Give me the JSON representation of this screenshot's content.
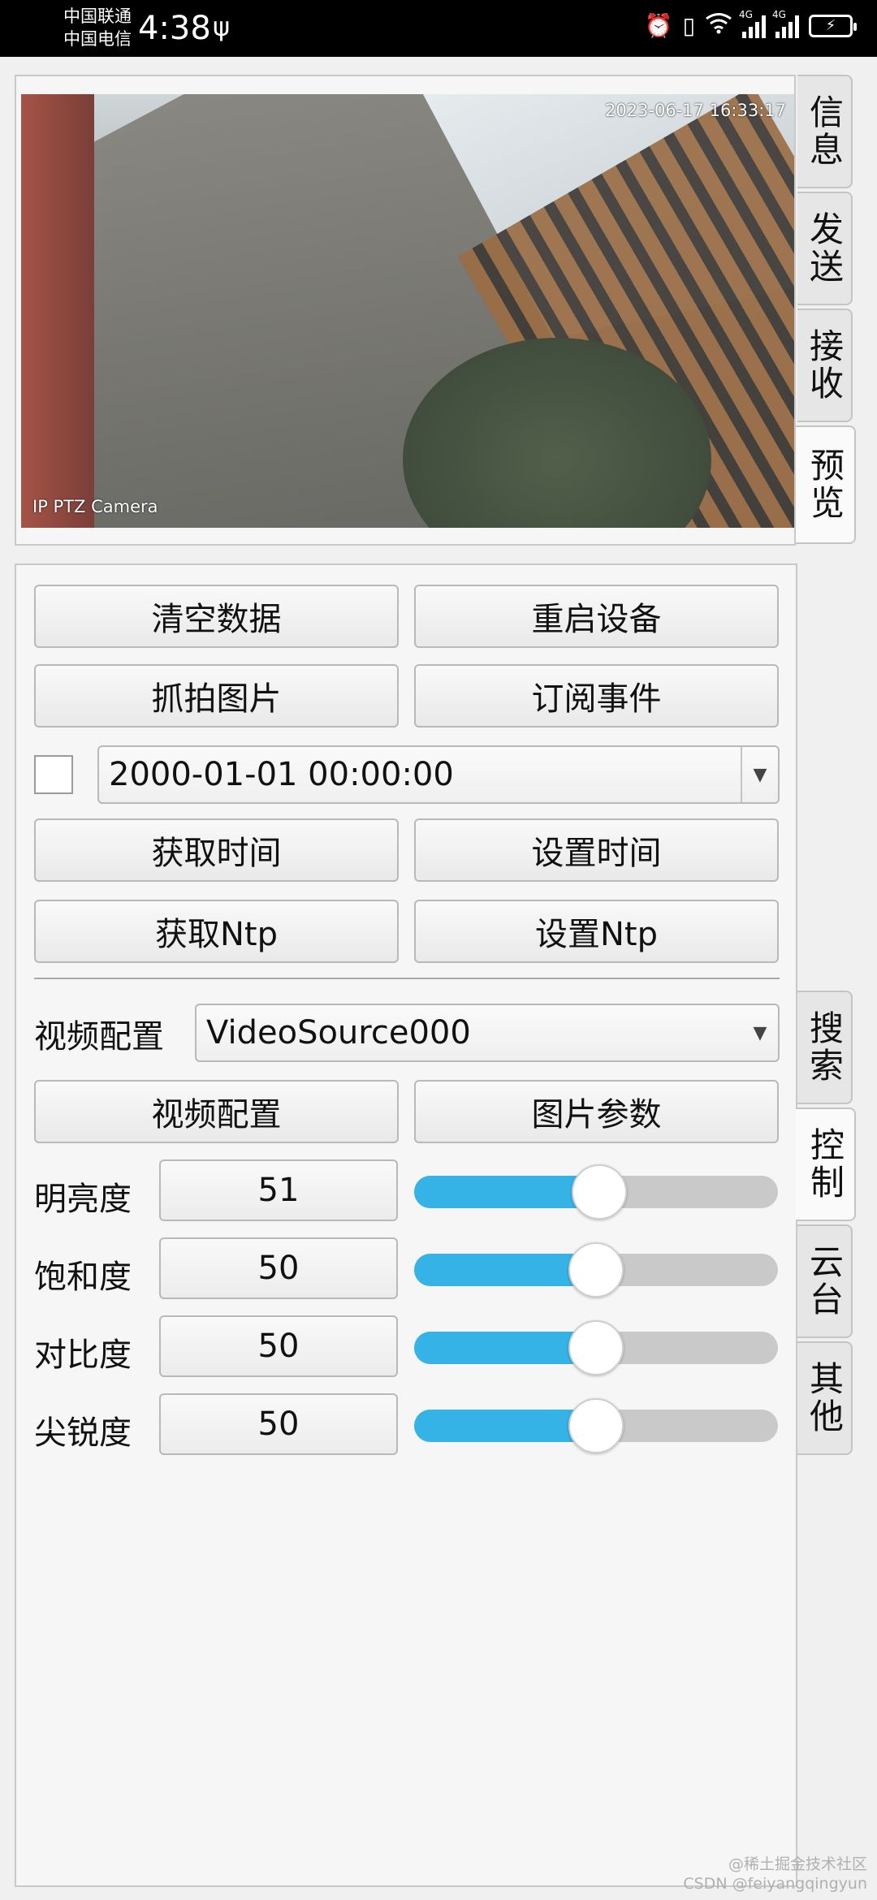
{
  "status_bar": {
    "carrier1": "中国联通",
    "carrier2": "中国电信",
    "time": "4:38",
    "network1": "4G",
    "network2": "4G"
  },
  "preview": {
    "timestamp": "2023-06-17 16:33:17",
    "camera_label": "IP PTZ Camera"
  },
  "top_tabs": [
    {
      "label": "信息"
    },
    {
      "label": "发送"
    },
    {
      "label": "接收"
    },
    {
      "label": "预览",
      "active": true
    }
  ],
  "side_tabs": [
    {
      "label": "搜索"
    },
    {
      "label": "控制",
      "active": true
    },
    {
      "label": "云台"
    },
    {
      "label": "其他"
    }
  ],
  "buttons": {
    "clear_data": "清空数据",
    "restart_device": "重启设备",
    "snapshot": "抓拍图片",
    "subscribe_events": "订阅事件",
    "get_time": "获取时间",
    "set_time": "设置时间",
    "get_ntp": "获取Ntp",
    "set_ntp": "设置Ntp",
    "video_config": "视频配置",
    "image_params": "图片参数"
  },
  "datetime_combo": {
    "checked": false,
    "value": "2000-01-01 00:00:00"
  },
  "video_config": {
    "label": "视频配置",
    "selected": "VideoSource000"
  },
  "image_settings": [
    {
      "label": "明亮度",
      "value": "51",
      "fraction": 0.51
    },
    {
      "label": "饱和度",
      "value": "50",
      "fraction": 0.5
    },
    {
      "label": "对比度",
      "value": "50",
      "fraction": 0.5
    },
    {
      "label": "尖锐度",
      "value": "50",
      "fraction": 0.5
    }
  ],
  "watermark": {
    "line1": "@稀土掘金技术社区",
    "line2": "CSDN @feiyangqingyun"
  },
  "colors": {
    "slider_fill": "#35b3e6",
    "slider_track": "#c9c9c9"
  }
}
